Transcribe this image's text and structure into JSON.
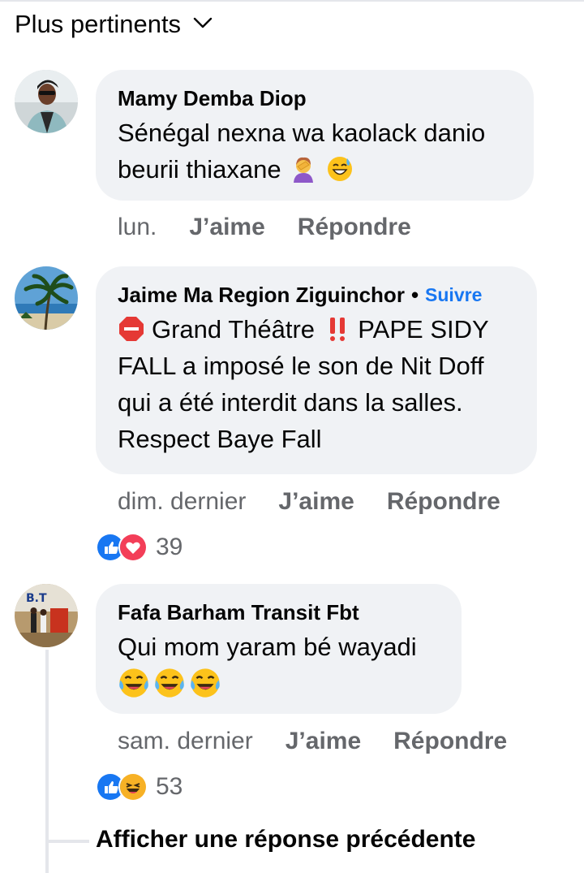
{
  "sort": {
    "label": "Plus pertinents"
  },
  "comments": [
    {
      "author": "Mamy Demba Diop",
      "text_lines": [
        "Sénégal nexna wa kaolack danio",
        "beurii thiaxane"
      ],
      "emojis": [
        "facepalm-woman-emoji",
        "sweat-smile-emoji"
      ],
      "time": "lun.",
      "like_label": "J’aime",
      "reply_label": "Répondre"
    },
    {
      "author": "Jaime Ma Region Ziguinchor",
      "separator": "•",
      "follow_label": "Suivre",
      "text_lines": [
        "Grand Théâtre",
        "PAPE SIDY",
        "FALL a imposé le son de Nit Doff",
        "qui a été interdit dans la salles.",
        "Respect Baye Fall"
      ],
      "emojis": [
        "stop-sign-emoji",
        "double-exclamation-emoji"
      ],
      "time": "dim. dernier",
      "like_label": "J’aime",
      "reply_label": "Répondre",
      "reactions": [
        "like-reaction-icon",
        "love-reaction-icon"
      ],
      "reaction_count": "39"
    },
    {
      "author": "Fafa Barham Transit Fbt",
      "text_lines": [
        "Qui mom yaram bé wayadi"
      ],
      "emojis": [
        "joy-emoji",
        "joy-emoji",
        "joy-emoji"
      ],
      "time": "sam. dernier",
      "like_label": "J’aime",
      "reply_label": "Répondre",
      "reactions": [
        "like-reaction-icon",
        "haha-reaction-icon"
      ],
      "reaction_count": "53",
      "avatar_text": "B.T"
    }
  ],
  "show_previous_reply": "Afficher une réponse précédente",
  "colors": {
    "bubble": "#f0f2f5",
    "link": "#1877f2",
    "meta": "#65676b",
    "like": "#1877f2",
    "love": "#f33e58"
  }
}
